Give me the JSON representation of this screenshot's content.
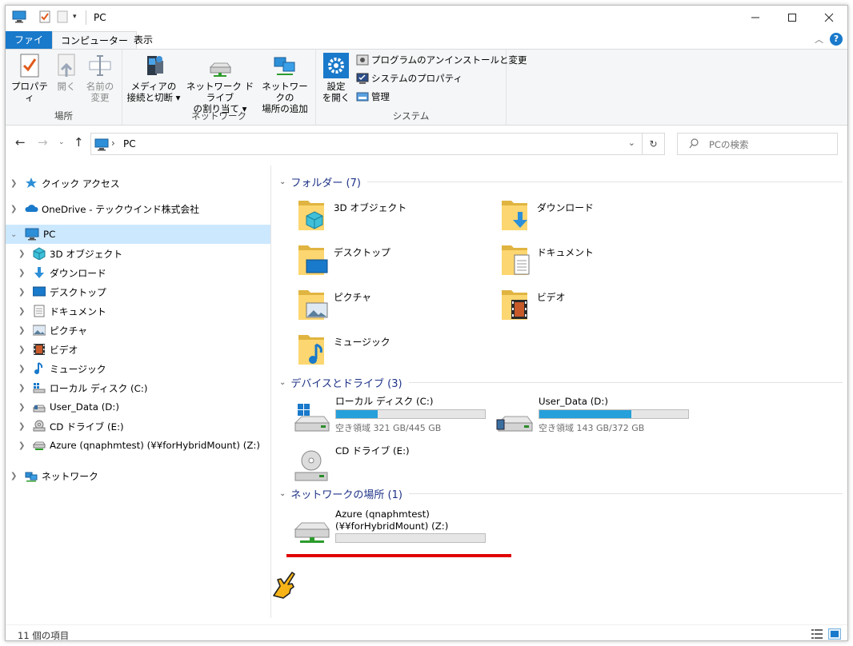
{
  "window": {
    "title": "PC"
  },
  "ribbon_tabs": [
    "ファイル",
    "コンピューター",
    "表示"
  ],
  "ribbon": {
    "location_group": {
      "label": "場所",
      "buttons": [
        {
          "line1": "プロパティ",
          "line2": "",
          "enabled": true
        },
        {
          "line1": "開く",
          "line2": "",
          "enabled": false
        },
        {
          "line1": "名前の",
          "line2": "変更",
          "enabled": false
        }
      ]
    },
    "network_group": {
      "label": "ネットワーク",
      "buttons": [
        {
          "line1": "メディアの",
          "line2": "接続と切断 ▾"
        },
        {
          "line1": "ネットワーク ドライブ",
          "line2": "の割り当て ▾"
        },
        {
          "line1": "ネットワークの",
          "line2": "場所の追加"
        }
      ]
    },
    "system_group": {
      "label": "システム",
      "settings": {
        "line1": "設定",
        "line2": "を開く"
      },
      "small_buttons": [
        "プログラムのアンインストールと変更",
        "システムのプロパティ",
        "管理"
      ]
    }
  },
  "address": {
    "path": "PC",
    "search_placeholder": "PCの検索"
  },
  "nav": {
    "quick_access": "クイック アクセス",
    "onedrive": "OneDrive - テックウインド株式会社",
    "pc": "PC",
    "pc_children": [
      "3D オブジェクト",
      "ダウンロード",
      "デスクトップ",
      "ドキュメント",
      "ピクチャ",
      "ビデオ",
      "ミュージック",
      "ローカル ディスク (C:)",
      "User_Data (D:)",
      "CD ドライブ (E:)",
      "Azure (qnaphmtest) (¥¥forHybridMount) (Z:)"
    ],
    "network": "ネットワーク"
  },
  "content": {
    "folders_header": "フォルダー (7)",
    "folders": [
      "3D オブジェクト",
      "ダウンロード",
      "デスクトップ",
      "ドキュメント",
      "ピクチャ",
      "ビデオ",
      "ミュージック"
    ],
    "devices_header": "デバイスとドライブ (3)",
    "drives": [
      {
        "name": "ローカル ディスク (C:)",
        "free": "空き領域 321 GB/445 GB",
        "used_fraction": 0.28
      },
      {
        "name": "User_Data (D:)",
        "free": "空き領域 143 GB/372 GB",
        "used_fraction": 0.62
      },
      {
        "name": "CD ドライブ (E:)"
      }
    ],
    "network_header": "ネットワークの場所 (1)",
    "network_location": {
      "line1": "Azure (qnaphmtest)",
      "line2": "(¥¥forHybridMount) (Z:)",
      "used_fraction": 0
    }
  },
  "status": {
    "item_count": "11 個の項目"
  },
  "colors": {
    "accent": "#1979ca",
    "bar_fill": "#26a0da",
    "selection": "#cce8ff",
    "annotation": "#e00000",
    "section_header": "#1e3287"
  }
}
